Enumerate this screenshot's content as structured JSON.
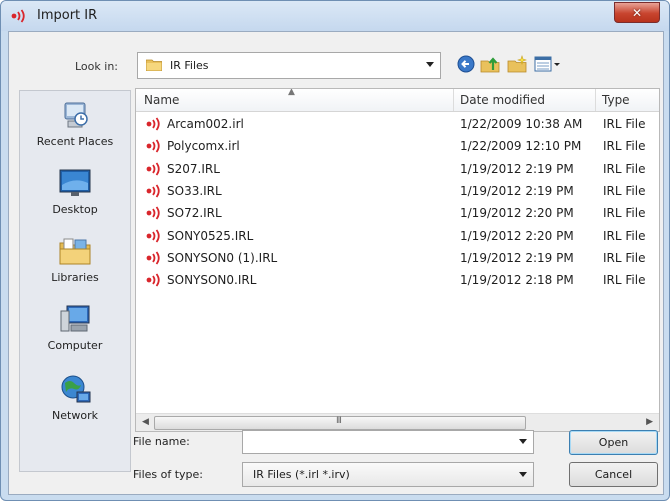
{
  "window": {
    "title": "Import IR",
    "close_symbol": "✕"
  },
  "toolbar": {
    "look_in_label": "Look in:",
    "look_in_value": "IR Files",
    "buttons": [
      "back-icon",
      "up-folder-icon",
      "new-folder-icon",
      "view-menu-icon"
    ]
  },
  "places": [
    {
      "label": "Recent Places",
      "icon": "recent-places-icon"
    },
    {
      "label": "Desktop",
      "icon": "desktop-icon"
    },
    {
      "label": "Libraries",
      "icon": "libraries-icon"
    },
    {
      "label": "Computer",
      "icon": "computer-icon"
    },
    {
      "label": "Network",
      "icon": "network-icon"
    }
  ],
  "columns": {
    "name": "Name",
    "date": "Date modified",
    "type": "Type"
  },
  "files": [
    {
      "name": "Arcam002.irl",
      "date": "1/22/2009 10:38 AM",
      "type": "IRL File"
    },
    {
      "name": "Polycomx.irl",
      "date": "1/22/2009 12:10 PM",
      "type": "IRL File"
    },
    {
      "name": "S207.IRL",
      "date": "1/19/2012 2:19 PM",
      "type": "IRL File"
    },
    {
      "name": "SO33.IRL",
      "date": "1/19/2012 2:19 PM",
      "type": "IRL File"
    },
    {
      "name": "SO72.IRL",
      "date": "1/19/2012 2:20 PM",
      "type": "IRL File"
    },
    {
      "name": "SONY0525.IRL",
      "date": "1/19/2012 2:20 PM",
      "type": "IRL File"
    },
    {
      "name": "SONYSON0 (1).IRL",
      "date": "1/19/2012 2:19 PM",
      "type": "IRL File"
    },
    {
      "name": "SONYSON0.IRL",
      "date": "1/19/2012 2:18 PM",
      "type": "IRL File"
    }
  ],
  "scrollbar": {
    "grip": "III"
  },
  "form": {
    "file_name_label": "File name:",
    "file_name_value": "",
    "files_of_type_label": "Files of type:",
    "files_of_type_value": "IR Files (*.irl *.irv)"
  },
  "buttons": {
    "open": "Open",
    "cancel": "Cancel"
  },
  "colors": {
    "ir_icon": "#d9262c",
    "title_bar": "#c9dcef",
    "close_button": "#c8452f"
  }
}
